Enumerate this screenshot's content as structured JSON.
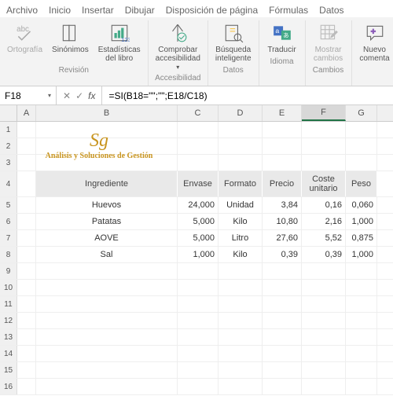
{
  "menubar": [
    "Archivo",
    "Inicio",
    "Insertar",
    "Dibujar",
    "Disposición de página",
    "Fórmulas",
    "Datos"
  ],
  "ribbon": {
    "groups": [
      {
        "name": "Revisión",
        "buttons": [
          {
            "id": "spelling",
            "label": "Ortografía",
            "disabled": true
          },
          {
            "id": "thesaurus",
            "label": "Sinónimos",
            "disabled": false
          },
          {
            "id": "stats",
            "label": "Estadísticas\ndel libro",
            "disabled": false
          }
        ]
      },
      {
        "name": "Accesibilidad",
        "buttons": [
          {
            "id": "check-access",
            "label": "Comprobar\naccesibilidad",
            "disabled": false,
            "dropdown": true
          }
        ]
      },
      {
        "name": "Datos",
        "buttons": [
          {
            "id": "smart-lookup",
            "label": "Búsqueda\ninteligente",
            "disabled": false
          }
        ]
      },
      {
        "name": "Idioma",
        "buttons": [
          {
            "id": "translate",
            "label": "Traducir",
            "disabled": false
          }
        ]
      },
      {
        "name": "Cambios",
        "buttons": [
          {
            "id": "show-changes",
            "label": "Mostrar\ncambios",
            "disabled": true
          }
        ]
      },
      {
        "name": "",
        "buttons": [
          {
            "id": "new-comment",
            "label": "Nuevo\ncomenta",
            "disabled": false
          }
        ]
      }
    ]
  },
  "namebox": "F18",
  "formula": "=SI(B18=\"\";\"\";E18/C18)",
  "columns": [
    "A",
    "B",
    "C",
    "D",
    "E",
    "F",
    "G"
  ],
  "selectedCol": "F",
  "logo": {
    "brand": "Sg",
    "tagline": "Análisis y Soluciones de Gestión"
  },
  "headers": {
    "B": "Ingrediente",
    "C": "Envase",
    "D": "Formato",
    "E": "Precio",
    "F": "Coste\nunitario",
    "G": "Peso"
  },
  "rows": [
    {
      "B": "Huevos",
      "C": "24,000",
      "D": "Unidad",
      "E": "3,84",
      "F": "0,16",
      "G": "0,060"
    },
    {
      "B": "Patatas",
      "C": "5,000",
      "D": "Kilo",
      "E": "10,80",
      "F": "2,16",
      "G": "1,000"
    },
    {
      "B": "AOVE",
      "C": "5,000",
      "D": "Litro",
      "E": "27,60",
      "F": "5,52",
      "G": "0,875"
    },
    {
      "B": "Sal",
      "C": "1,000",
      "D": "Kilo",
      "E": "0,39",
      "F": "0,39",
      "G": "1,000"
    }
  ],
  "chart_data": {
    "type": "table",
    "title": "Ingrediente costs",
    "columns": [
      "Ingrediente",
      "Envase",
      "Formato",
      "Precio",
      "Coste unitario",
      "Peso"
    ],
    "rows": [
      [
        "Huevos",
        24.0,
        "Unidad",
        3.84,
        0.16,
        0.06
      ],
      [
        "Patatas",
        5.0,
        "Kilo",
        10.8,
        2.16,
        1.0
      ],
      [
        "AOVE",
        5.0,
        "Litro",
        27.6,
        5.52,
        0.875
      ],
      [
        "Sal",
        1.0,
        "Kilo",
        0.39,
        0.39,
        1.0
      ]
    ]
  }
}
